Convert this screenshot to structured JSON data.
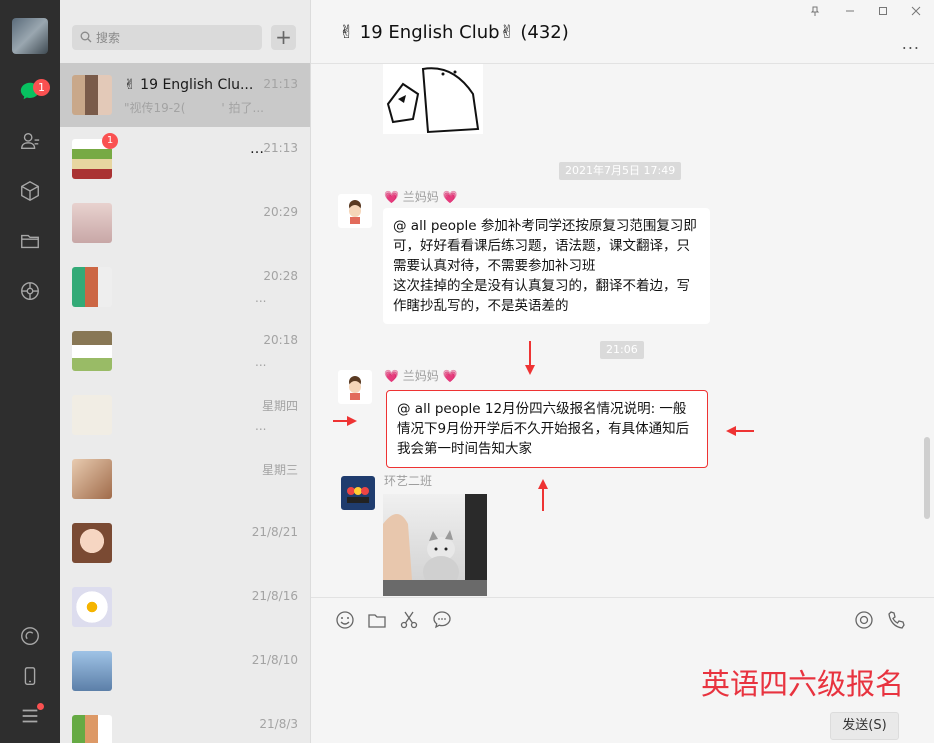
{
  "sidebar": {
    "badge": "1"
  },
  "conversations": {
    "search_placeholder": "搜索",
    "add_label": "+",
    "items": [
      {
        "name": "✌ 19 English Clu...",
        "time": "21:13",
        "preview": "\"视传19-2(　　　' 拍了...",
        "selected": true
      },
      {
        "name": "…",
        "time": "21:13",
        "preview": "",
        "badge": "1"
      },
      {
        "name": "",
        "time": "20:29",
        "preview": ""
      },
      {
        "name": "",
        "time": "20:28",
        "preview": "..."
      },
      {
        "name": "",
        "time": "20:18",
        "preview": "..."
      },
      {
        "name": "",
        "time": "星期四",
        "preview": "..."
      },
      {
        "name": "",
        "time": "星期三",
        "preview": ""
      },
      {
        "name": "",
        "time": "21/8/21",
        "preview": ""
      },
      {
        "name": "",
        "time": "21/8/16",
        "preview": ""
      },
      {
        "name": "",
        "time": "21/8/10",
        "preview": ""
      },
      {
        "name": "",
        "time": "21/8/3",
        "preview": ""
      }
    ]
  },
  "chat": {
    "title": "✌ 19 English Club✌ (432)",
    "more_label": "...",
    "timestamp1": "2021年7月5日 17:49",
    "timestamp2": "21:06",
    "sender1": "兰妈妈",
    "message1": "@ all people 参加补考同学还按原复习范围复习即可，好好看看课后练习题，语法题，课文翻译，只需要认真对待，不需要参加补习班\n这次挂掉的全是没有认真复习的，翻译不着边，写作瞎抄乱写的，不是英语差的",
    "sender2": "兰妈妈",
    "message2": "@ all people 12月份四六级报名情况说明: 一般情况下9月份开学后不久开始报名，有具体通知后我会第一时间告知大家",
    "sender3": "环艺二班",
    "overlay_caption": "英语四六级报名",
    "send_label": "发送(S)"
  },
  "colors": {
    "accent_red": "#e8333f",
    "badge_red": "#fa5151"
  }
}
